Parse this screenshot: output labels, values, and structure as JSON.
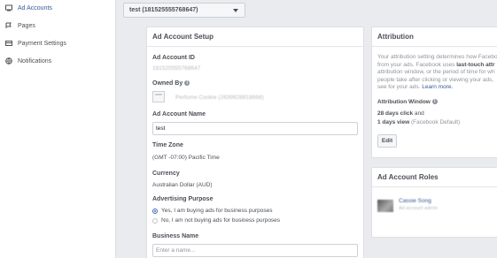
{
  "sidebar": {
    "items": [
      {
        "label": "Ad Accounts",
        "icon": "ad-accounts-icon"
      },
      {
        "label": "Pages",
        "icon": "pages-icon"
      },
      {
        "label": "Payment Settings",
        "icon": "credit-card-icon"
      },
      {
        "label": "Notifications",
        "icon": "globe-icon"
      }
    ]
  },
  "account_selector": {
    "value": "test (181525555768647)"
  },
  "setup": {
    "title": "Ad Account Setup",
    "account_id_label": "Ad Account ID",
    "account_id_value": "181525555768647",
    "owned_by_label": "Owned By",
    "owned_by_value": "Perfume Cookie (2639828818668)",
    "name_label": "Ad Account Name",
    "name_value": "test",
    "timezone_label": "Time Zone",
    "timezone_value": "(GMT -07:00) Pacific Time",
    "currency_label": "Currency",
    "currency_value": "Australian Dollar (AUD)",
    "purpose_label": "Advertising Purpose",
    "purpose_options": [
      "Yes, I am buying ads for business purposes",
      "No, I am not buying ads for business purposes"
    ],
    "purpose_selected": 0,
    "business_name_label": "Business Name",
    "business_name_placeholder": "Enter a name..."
  },
  "attribution": {
    "title": "Attribution",
    "lines": {
      "l1": "Your attribution setting determines how Facebo",
      "l2_pre": "from your ads. Facebook uses ",
      "l2_bold": "last-touch attr",
      "l3": "attribution window, or the period of time for wh",
      "l4": "people take after clicking or viewing your ads,",
      "l5_pre": "see for your ads. ",
      "l5_link": "Learn more."
    },
    "window_label": "Attribution Window",
    "click_value": "28 days click",
    "click_suffix": " and",
    "view_value": "1 days view",
    "view_suffix": " (Facebook Default)",
    "edit_label": "Edit"
  },
  "roles": {
    "title": "Ad Account Roles",
    "member_name": "Cassie Song",
    "member_role": "Ad account admin"
  },
  "colors": {
    "accent": "#4267b2",
    "link": "#365899",
    "background": "#e9ebee"
  }
}
